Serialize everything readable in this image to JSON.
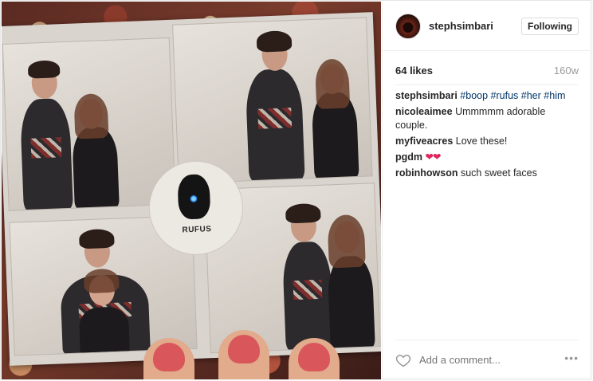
{
  "post": {
    "image_alt": "Photo booth strip",
    "logo_text": "RUFUS"
  },
  "header": {
    "username": "stephsimbari",
    "follow_label": "Following"
  },
  "stats": {
    "likes": "64 likes",
    "time": "160w"
  },
  "comments": [
    {
      "user": "stephsimbari",
      "text": "",
      "tags": [
        "#boop",
        "#rufus",
        "#her",
        "#him"
      ]
    },
    {
      "user": "nicoleaimee",
      "text": "Ummmmm adorable couple."
    },
    {
      "user": "myfiveacres",
      "text": "Love these!"
    },
    {
      "user": "pgdm",
      "text": "❤❤"
    },
    {
      "user": "robinhowson",
      "text": "such sweet faces"
    }
  ],
  "footer": {
    "add_comment_placeholder": "Add a comment...",
    "more_label": "•••"
  },
  "icons": {
    "like": "heart-icon",
    "more": "more-options-icon"
  },
  "colors": {
    "hashtag": "#003569",
    "muted": "#999999",
    "emoji_heart": "#e0245e"
  }
}
